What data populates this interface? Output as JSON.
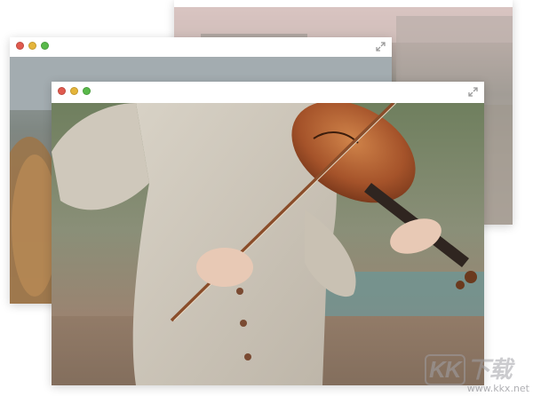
{
  "windows": [
    {
      "id": "back",
      "lights": [
        "#e05a4e",
        "#e5b53a",
        "#59b94a"
      ]
    },
    {
      "id": "middle",
      "lights": [
        "#e05a4e",
        "#e5b53a",
        "#59b94a"
      ]
    },
    {
      "id": "front",
      "lights": [
        "#e05a4e",
        "#e5b53a",
        "#59b94a"
      ]
    }
  ],
  "photo": {
    "subject": "violin-player-photo"
  },
  "watermark": {
    "logo_kk": "KK",
    "logo_chars": "下载",
    "url": "www.kkx.net"
  },
  "colors": {
    "sweater": "#cfc8bb",
    "hair": "#8b4a2b",
    "violin": "#a5532a"
  }
}
